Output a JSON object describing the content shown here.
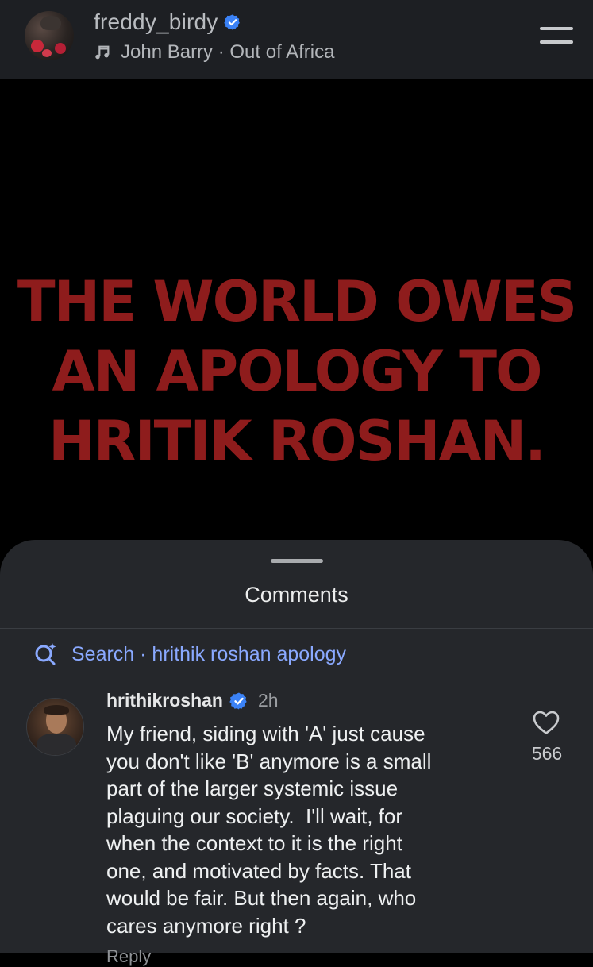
{
  "post": {
    "username": "freddy_birdy",
    "music": "John Barry · Out of Africa"
  },
  "image": {
    "headline_lines": [
      "THE WORLD OWES",
      "AN APOLOGY TO",
      "HRITIK ROSHAN."
    ],
    "headline_color": "#8e1c1c"
  },
  "comments": {
    "title": "Comments",
    "search_text": "Search · hrithik roshan apology",
    "items": [
      {
        "username": "hrithikroshan",
        "time": "2h",
        "lines": [
          "My friend, siding with 'A' just cause",
          "you don't like 'B' anymore is a small",
          "part of the larger systemic issue",
          "plaguing our society.  I'll wait, for",
          "when the context to it is the right",
          "one, and motivated by facts. That",
          "would be fair. But then again, who",
          "cares anymore right ?"
        ],
        "likes": "566",
        "reply_label": "Reply"
      }
    ]
  },
  "colors": {
    "background": "#000000",
    "header": "#1d1f23",
    "sheet": "#25272b",
    "accent_link": "#8aa9ff",
    "verified_badge": "#3b82f6"
  },
  "icons": {
    "verified": "verified-badge-icon",
    "music": "music-note-icon",
    "menu": "menu-icon",
    "search": "search-sparkle-icon",
    "like": "heart-icon"
  }
}
